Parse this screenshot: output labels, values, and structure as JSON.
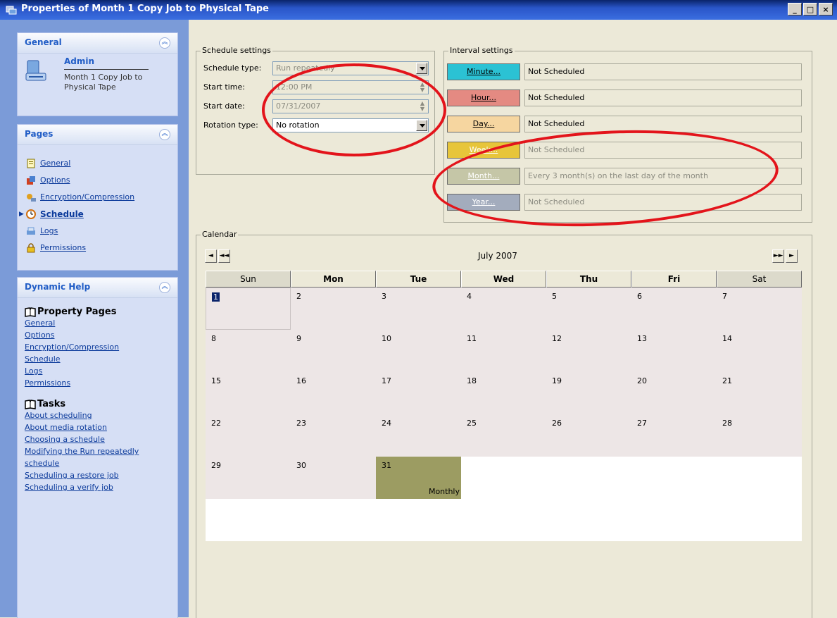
{
  "window": {
    "title": "Properties of Month 1 Copy Job to Physical Tape",
    "minimize_label": "_",
    "maximize_label": "□",
    "close_label": "×"
  },
  "sidebar": {
    "general": {
      "header": "General",
      "name": "Admin",
      "description": "Month 1 Copy Job to Physical Tape"
    },
    "pages": {
      "header": "Pages",
      "items": [
        {
          "label": "General",
          "icon": "page-icon"
        },
        {
          "label": "Options",
          "icon": "options-icon"
        },
        {
          "label": "Encryption/Compression",
          "icon": "encryption-icon"
        },
        {
          "label": "Schedule",
          "icon": "clock-icon"
        },
        {
          "label": "Logs",
          "icon": "logs-icon"
        },
        {
          "label": "Permissions",
          "icon": "lock-icon"
        }
      ]
    },
    "help": {
      "header": "Dynamic Help",
      "sections": [
        {
          "title": "Property Pages",
          "links": [
            "General",
            "Options",
            "Encryption/Compression",
            "Schedule",
            "Logs",
            "Permissions"
          ]
        },
        {
          "title": "Tasks",
          "links": [
            "About scheduling",
            "About media rotation",
            "Choosing a schedule",
            "Modifying the Run repeatedly schedule",
            "Scheduling a restore job",
            "Scheduling a verify job"
          ]
        }
      ]
    }
  },
  "schedule": {
    "group_title": "Schedule settings",
    "type_label": "Schedule type:",
    "type_value": "Run repeatedly",
    "start_time_label": "Start time:",
    "start_time_value": "12:00 PM",
    "start_date_label": "Start date:",
    "start_date_value": "07/31/2007",
    "rotation_label": "Rotation type:",
    "rotation_value": "No rotation"
  },
  "interval": {
    "group_title": "Interval settings",
    "rows": [
      {
        "label": "Minute...",
        "value": "Not Scheduled",
        "color": "#2bc2d4"
      },
      {
        "label": "Hour...",
        "value": "Not Scheduled",
        "color": "#e48a82"
      },
      {
        "label": "Day...",
        "value": "Not Scheduled",
        "color": "#f6d6a0"
      },
      {
        "label": "Week...",
        "value": "Not Scheduled",
        "color": "#e7c53a"
      },
      {
        "label": "Month...",
        "value": "Every 3 month(s) on the last day of the month",
        "color": "#c5c6a7"
      },
      {
        "label": "Year...",
        "value": "Not Scheduled",
        "color": "#a3acbd"
      }
    ]
  },
  "calendar": {
    "group_title": "Calendar",
    "month_label": "July 2007",
    "weekdays": [
      "Sun",
      "Mon",
      "Tue",
      "Wed",
      "Thu",
      "Fri",
      "Sat"
    ],
    "weeks": [
      [
        "1",
        "2",
        "3",
        "4",
        "5",
        "6",
        "7"
      ],
      [
        "8",
        "9",
        "10",
        "11",
        "12",
        "13",
        "14"
      ],
      [
        "15",
        "16",
        "17",
        "18",
        "19",
        "20",
        "21"
      ],
      [
        "22",
        "23",
        "24",
        "25",
        "26",
        "27",
        "28"
      ],
      [
        "29",
        "30",
        "31",
        "",
        "",
        "",
        ""
      ]
    ],
    "selected_day": "1",
    "event_day": "31",
    "event_label": "Monthly",
    "event_color": "#9c9c62",
    "prev_month": "◄",
    "prev_year": "◄◄",
    "next_year": "►►",
    "next_month": "►"
  },
  "annotation_color": "#e3141b"
}
